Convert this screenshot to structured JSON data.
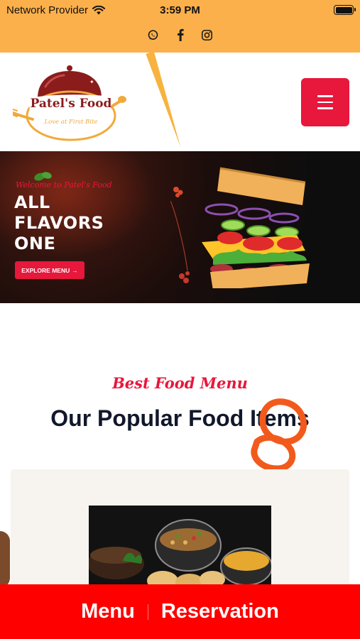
{
  "status_bar": {
    "carrier": "Network Provider",
    "time": "3:59 PM"
  },
  "social_links": [
    {
      "icon": "whatsapp-icon"
    },
    {
      "icon": "facebook-icon"
    },
    {
      "icon": "instagram-icon"
    }
  ],
  "header": {
    "logo_text": "Patel's Food",
    "logo_tagline": "Love at First Bite",
    "menu_button": {
      "icon": "hamburger-menu-icon"
    }
  },
  "hero": {
    "welcome": "Welcome to Patel's Food",
    "title_lines": [
      "ALL",
      "FLAVORS",
      "ONE"
    ],
    "cta_label": "EXPLORE MENU",
    "cta_icon": "→"
  },
  "section": {
    "subheading": "Best Food Menu",
    "heading": "Our Popular Food Items"
  },
  "bottom_bar": {
    "menu_label": "Menu",
    "reservation_label": "Reservation"
  },
  "colors": {
    "top_band": "#fbb04b",
    "accent_red": "#e8173c",
    "bottom_bar": "#fe0000",
    "heading_navy": "#12182b"
  }
}
